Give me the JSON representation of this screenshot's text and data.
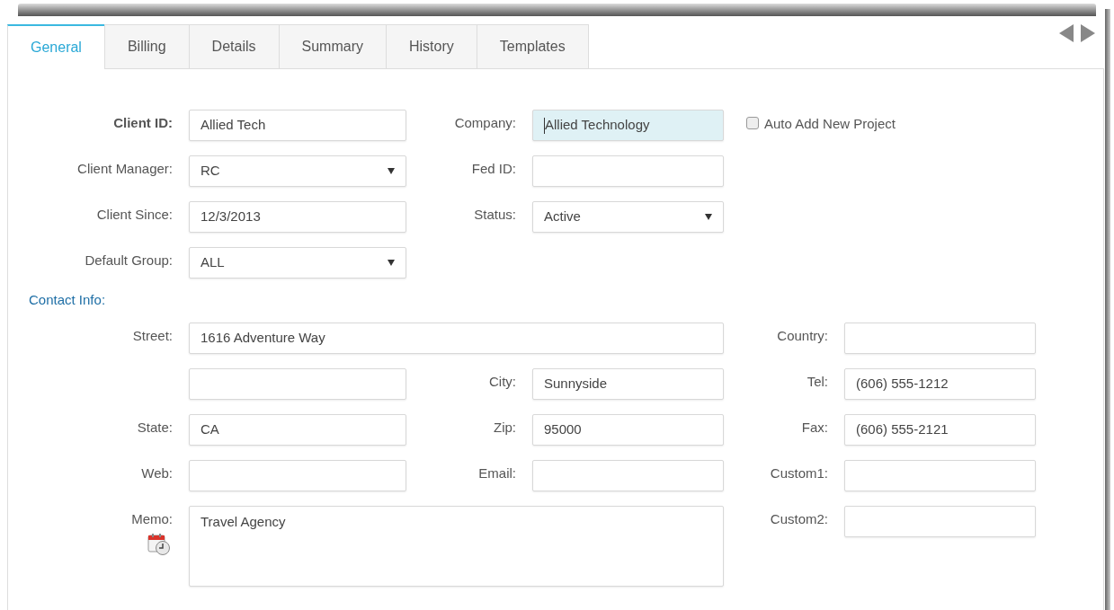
{
  "tabs": [
    {
      "label": "General",
      "selected": true
    },
    {
      "label": "Billing",
      "selected": false
    },
    {
      "label": "Details",
      "selected": false
    },
    {
      "label": "Summary",
      "selected": false
    },
    {
      "label": "History",
      "selected": false
    },
    {
      "label": "Templates",
      "selected": false
    }
  ],
  "client_rows": [
    [
      {
        "kind": "text",
        "label": "Client ID:",
        "bold": true,
        "value": "Allied Tech",
        "focused": false
      },
      {
        "kind": "text",
        "label": "Company:",
        "bold": false,
        "value": "Allied Technology",
        "focused": true
      },
      {
        "kind": "checkbox",
        "label": "Auto Add New Project",
        "checked": false
      }
    ],
    [
      {
        "kind": "select",
        "label": "Client Manager:",
        "bold": false,
        "value": "RC",
        "focused": false
      },
      {
        "kind": "text",
        "label": "Fed ID:",
        "bold": false,
        "focused": false
      }
    ],
    [
      {
        "kind": "text",
        "label": "Client Since:",
        "bold": false,
        "value": "12/3/2013",
        "focused": false
      },
      {
        "kind": "select",
        "label": "Status:",
        "bold": false,
        "value": "Active",
        "focused": false
      }
    ],
    [
      {
        "kind": "select",
        "label": "Default Group:",
        "bold": false,
        "value": "ALL",
        "focused": false
      }
    ]
  ],
  "contact_heading": "Contact Info:",
  "contact_rows": [
    [
      {
        "kind": "wide",
        "label": "Street:",
        "value": "1616 Adventure Way"
      },
      {
        "kind": "text",
        "label": "Country:"
      }
    ],
    [
      {
        "kind": "text"
      },
      {
        "kind": "text",
        "label": "City:",
        "value": "Sunnyside"
      },
      {
        "kind": "text",
        "label": "Tel:",
        "value": "(606) 555-1212"
      }
    ],
    [
      {
        "kind": "text",
        "label": "State:",
        "value": "CA"
      },
      {
        "kind": "text",
        "label": "Zip:",
        "value": "95000"
      },
      {
        "kind": "text",
        "label": "Fax:",
        "value": "(606) 555-2121"
      }
    ],
    [
      {
        "kind": "text",
        "label": "Web:"
      },
      {
        "kind": "text",
        "label": "Email:"
      },
      {
        "kind": "text",
        "label": "Custom1:"
      }
    ],
    [
      {
        "kind": "memo",
        "label": "Memo:",
        "value": "Travel Agency"
      },
      {
        "kind": "text",
        "label": "Custom2:"
      }
    ]
  ]
}
